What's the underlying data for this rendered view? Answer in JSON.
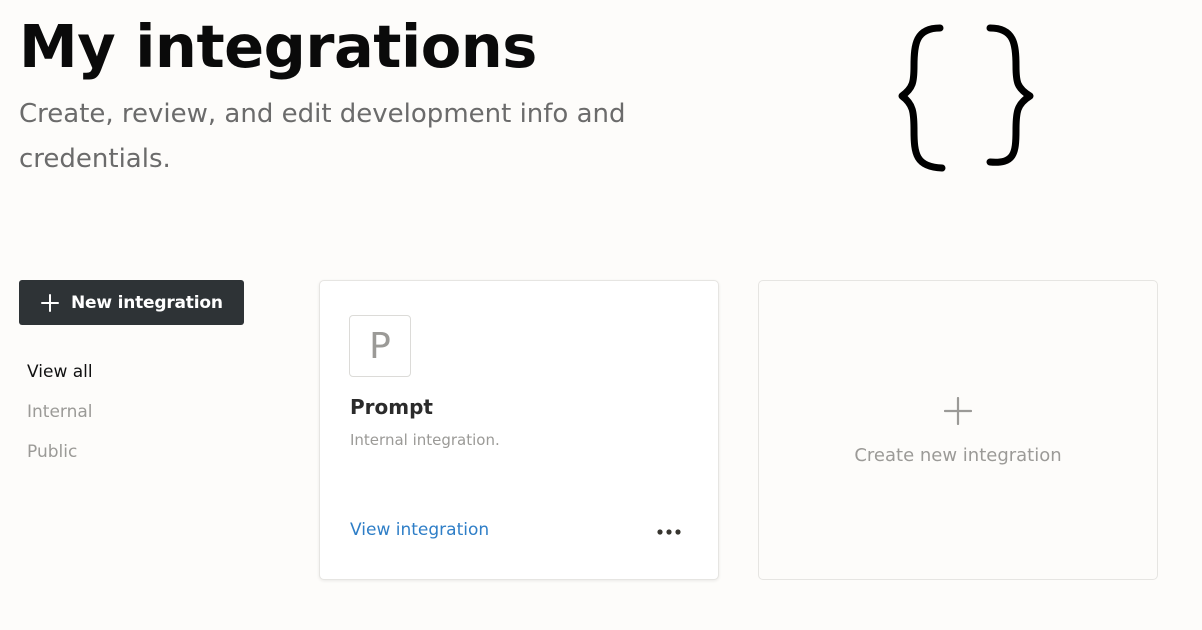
{
  "header": {
    "title": "My integrations",
    "subtitle": "Create, review, and edit development info and credentials."
  },
  "sidebar": {
    "new_button_label": "New integration",
    "new_button_icon": "plus-icon",
    "filters": [
      {
        "label": "View all",
        "active": true
      },
      {
        "label": "Internal",
        "active": false
      },
      {
        "label": "Public",
        "active": false
      }
    ]
  },
  "integrations": [
    {
      "avatar_letter": "P",
      "name": "Prompt",
      "description": "Internal integration.",
      "link_label": "View integration",
      "menu_icon": "more-horizontal-icon"
    }
  ],
  "create_card": {
    "label": "Create new integration",
    "icon": "plus-icon"
  },
  "illustration": {
    "icon": "curly-braces-icon"
  },
  "colors": {
    "background": "#fdfcfa",
    "button_bg": "#2e3336",
    "link": "#2e7ec7",
    "muted_text": "#9b9a97"
  }
}
